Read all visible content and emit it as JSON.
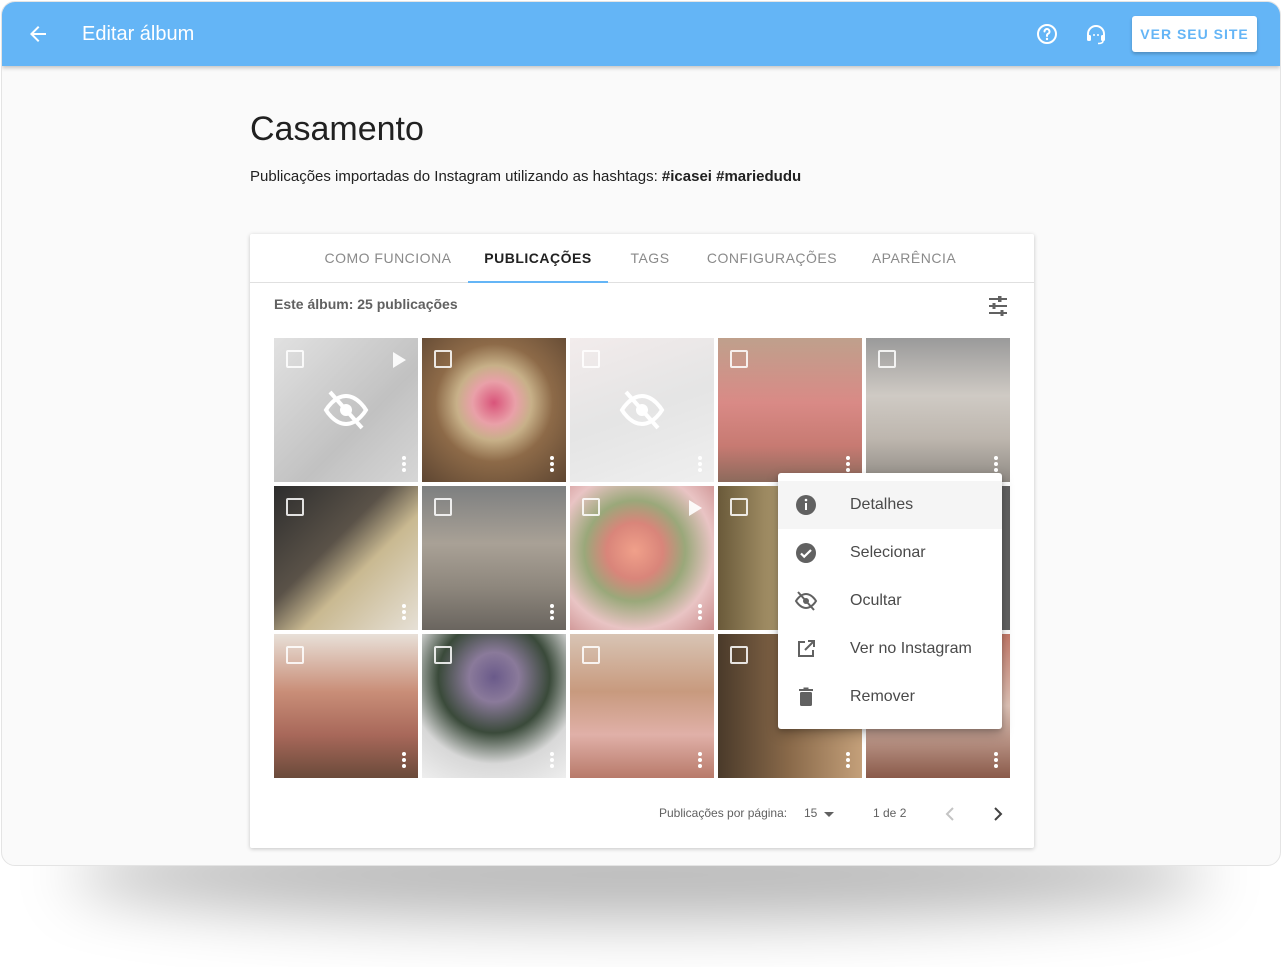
{
  "appbar": {
    "title": "Editar álbum",
    "site_button": "VER SEU SITE",
    "color": "#64b5f6"
  },
  "header": {
    "title": "Casamento",
    "subtitle_text": "Publicações importadas do Instagram utilizando as hashtags: ",
    "hashtags": "#icasei #mariedudu"
  },
  "tabs": [
    {
      "label": "COMO FUNCIONA"
    },
    {
      "label": "PUBLICAÇÕES"
    },
    {
      "label": "TAGS"
    },
    {
      "label": "CONFIGURAÇÕES"
    },
    {
      "label": "APARÊNCIA"
    }
  ],
  "album": {
    "count_label": "Este álbum: 25 publicações"
  },
  "pagination": {
    "per_page_label": "Publicações por página:",
    "per_page_value": "15",
    "range": "1 de 2"
  },
  "context_menu": [
    {
      "label": "Detalhes",
      "icon": "info-icon"
    },
    {
      "label": "Selecionar",
      "icon": "check-circle-icon"
    },
    {
      "label": "Ocultar",
      "icon": "eye-off-icon"
    },
    {
      "label": "Ver no Instagram",
      "icon": "open-in-new-icon"
    },
    {
      "label": "Remover",
      "icon": "trash-icon"
    }
  ]
}
